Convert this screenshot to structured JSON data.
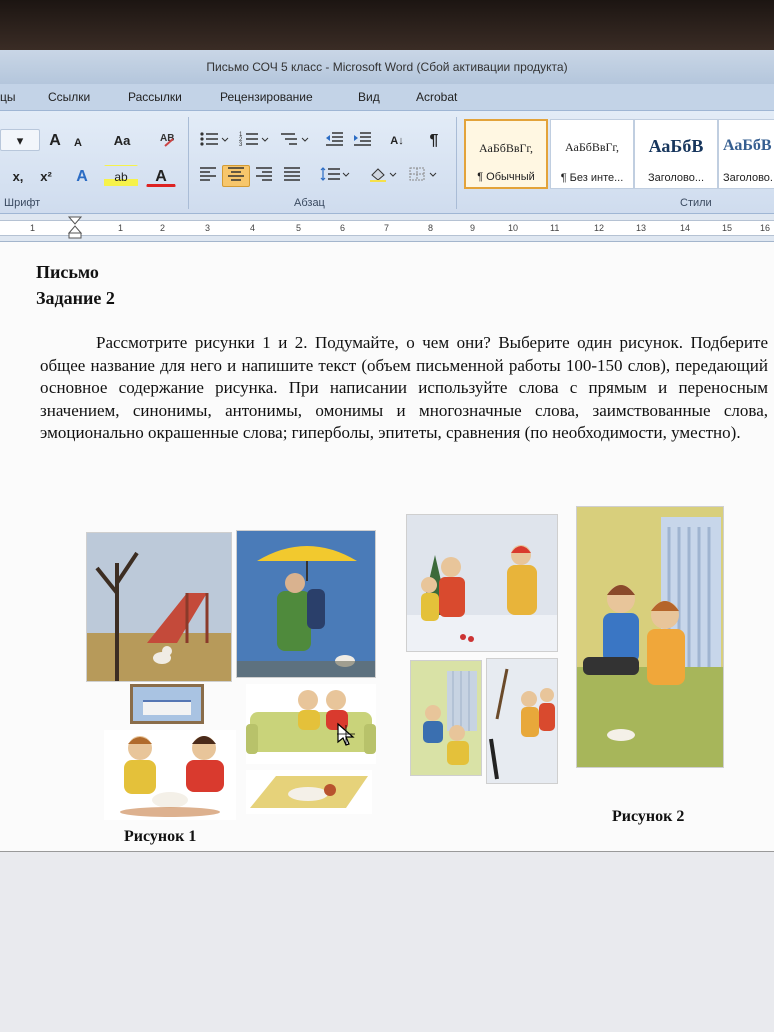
{
  "window": {
    "title": "Письмо СОЧ 5 класс  -  Microsoft Word (Сбой активации продукта)"
  },
  "ribbon_tabs": [
    "цы",
    "Ссылки",
    "Рассылки",
    "Рецензирование",
    "Вид",
    "Acrobat"
  ],
  "ribbon": {
    "font_group_label": "Шрифт",
    "paragraph_group_label": "Абзац",
    "styles_group_label": "Стили",
    "font_buttons": {
      "grow": "A",
      "shrink": "A",
      "change_case": "Aa",
      "subscript": "x,",
      "superscript": "x²",
      "text_effects": "A",
      "highlight": "ab",
      "font_color": "A"
    },
    "pilcrow": "¶",
    "sort": "A↓",
    "styles": [
      {
        "sample": "АаБбВвГг,",
        "name": "¶ Обычный",
        "selected": true
      },
      {
        "sample": "АаБбВвГг,",
        "name": "¶ Без инте...",
        "selected": false
      },
      {
        "sample": "АаБбВ",
        "name": "Заголово...",
        "selected": false
      },
      {
        "sample": "АаБбВ",
        "name": "Заголово...",
        "selected": false
      }
    ]
  },
  "ruler": {
    "ticks": [
      "1",
      "1",
      "2",
      "3",
      "4",
      "5",
      "6",
      "7",
      "8",
      "9",
      "10",
      "11",
      "12",
      "13",
      "14",
      "15",
      "16"
    ]
  },
  "document": {
    "heading1": "Письмо",
    "heading2": "Задание 2",
    "paragraph": "Рассмотрите рисунки 1 и 2. Подумайте, о чем они? Выберите один рисунок. Подберите общее название для него и  напишите текст (объем письменной работы 100-150 слов), передающий основное содержание рисунка. При написании используйте слова с прямым и переносным значением, синонимы, антонимы, омонимы и многозначные слова, заимствованные слова, эмоционально окрашенные слова; гиперболы, эпитеты, сравнения (по необходимости, уместно).",
    "caption1": "Рисунок 1",
    "caption2": "Рисунок 2"
  },
  "colors": {
    "ribbon_bg": "#dbe6f3",
    "selected_style": "#e3a33a",
    "active_align": "#f7c66b"
  },
  "icons": [
    "bullets-icon",
    "numbering-icon",
    "multilevel-icon",
    "decrease-indent-icon",
    "increase-indent-icon",
    "sort-icon",
    "pilcrow-icon",
    "align-left-icon",
    "align-center-icon",
    "align-right-icon",
    "justify-icon",
    "line-spacing-icon",
    "shading-icon",
    "borders-icon",
    "mouse-pointer-icon"
  ]
}
